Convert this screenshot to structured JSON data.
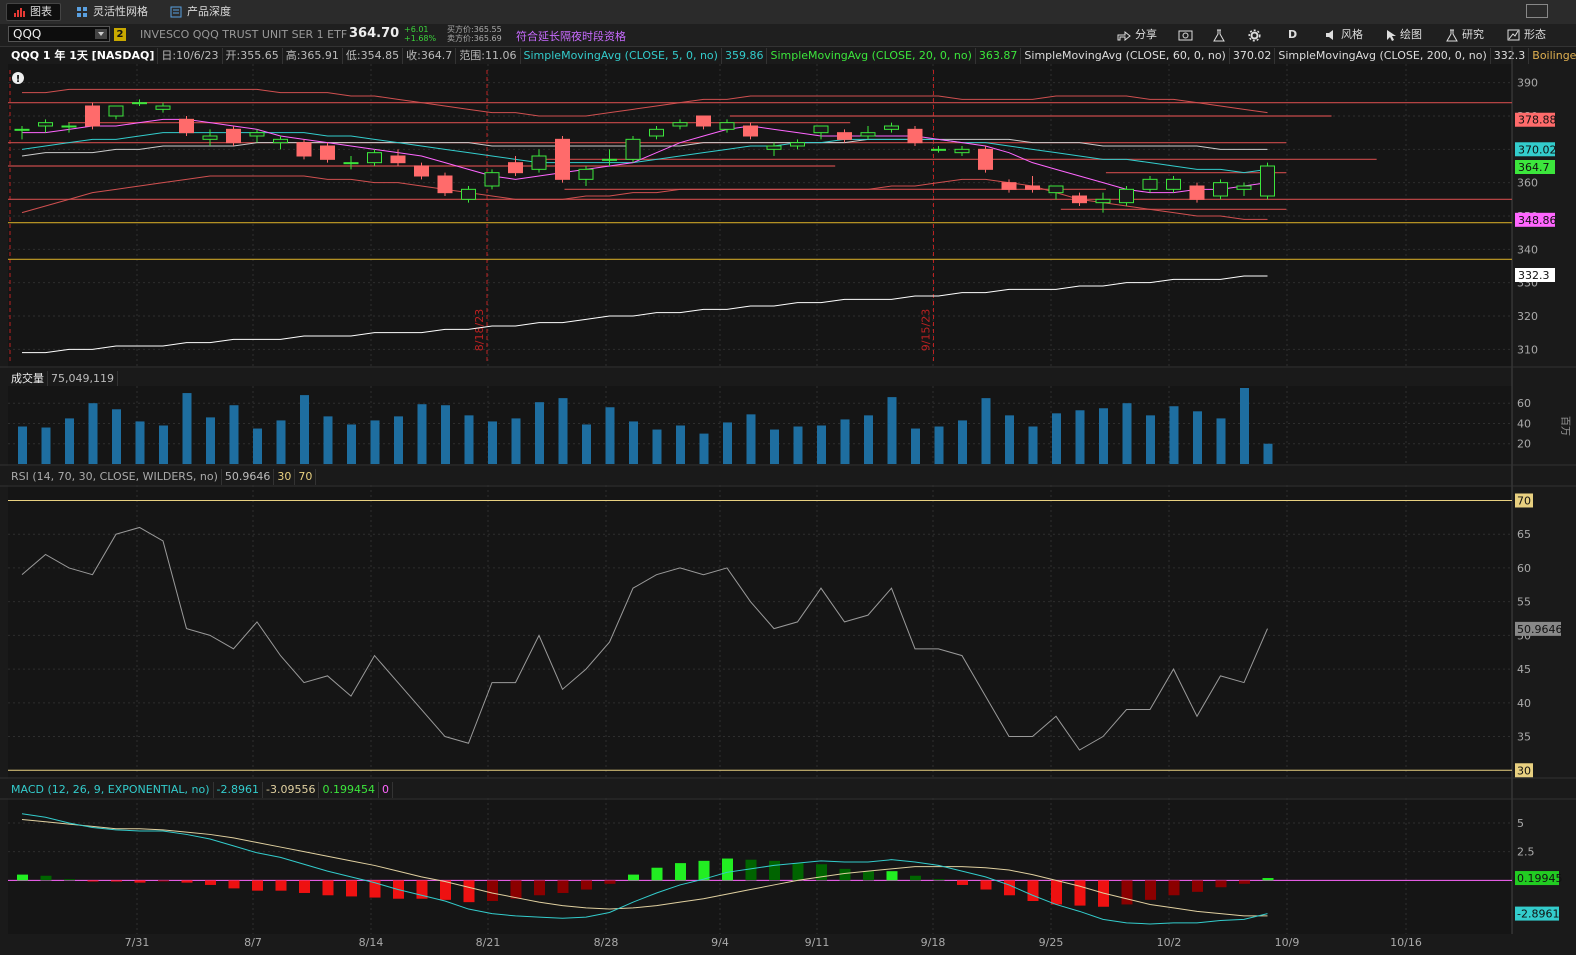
{
  "tabs": [
    {
      "label": "图表",
      "active": true,
      "icon": "bar-chart-icon"
    },
    {
      "label": "灵活性网格",
      "active": false,
      "icon": "grid-icon"
    },
    {
      "label": "产品深度",
      "active": false,
      "icon": "depth-icon"
    }
  ],
  "symbol": "QQQ",
  "link_badge": "2",
  "description": "INVESCO QQQ TRUST UNIT SER 1 ETF",
  "last_price": "364.70",
  "change": "+6.01",
  "change_pct": "+1.68%",
  "bid": "买方价:365.55",
  "ask": "卖方价:365.69",
  "extended_hours": "符合延长隔夜时段资格",
  "toolbar": {
    "share": "分享",
    "period": "D",
    "style": "风格",
    "draw": "绘图",
    "study": "研究",
    "pattern": "形态"
  },
  "price_legend": {
    "title": "QQQ 1 年 1天 [NASDAQ]",
    "date": "日:10/6/23",
    "open": "开:355.65",
    "high": "高:365.91",
    "low": "低:354.85",
    "close": "收:364.7",
    "range": "范围:11.06",
    "sma5": "SimpleMovingAvg (CLOSE, 5, 0, no)",
    "sma5_v": "359.86",
    "sma20": "SimpleMovingAvg (CLOSE, 20, 0, no)",
    "sma20_v": "363.87",
    "sma60": "SimpleMovingAvg (CLOSE, 60, 0, no)",
    "sma60_v": "370.02",
    "sma200": "SimpleMovingAvg (CLOSE, 200, 0, no)",
    "sma200_v": "332.3",
    "bollinger": "Boilinger..."
  },
  "volume_legend": {
    "title": "成交量",
    "value": "75,049,119",
    "unit": "百万"
  },
  "rsi_legend": {
    "title": "RSI (14, 70, 30, CLOSE, WILDERS, no)",
    "value": "50.9646",
    "os": "30",
    "ob": "70"
  },
  "macd_legend": {
    "title": "MACD (12, 26, 9, EXPONENTIAL, no)",
    "value": "-2.8961",
    "avg": "-3.09556",
    "diff": "0.199454",
    "zero": "0"
  },
  "vline_labels": [
    "8/18/23",
    "9/15/23"
  ],
  "colors": {
    "up": "#3ce63c",
    "down": "#ff6b6b",
    "sma5": "#ff66ff",
    "sma20": "#33cccc",
    "sma60": "#cccccc",
    "sma200": "#ffffff",
    "bb": "#d05050",
    "vol": "#1e6ea0",
    "rsi": "#9a9a9a",
    "macd": "#33cccc",
    "macd_avg": "#e0d0a0",
    "hist_up": "#22ee22",
    "hist_up_dim": "#006400",
    "hist_dn": "#ee1111",
    "hist_dn_dim": "#8b0000"
  },
  "chart_data": [
    {
      "type": "candlestick",
      "x_ticks": [
        "7/31",
        "8/7",
        "8/14",
        "8/21",
        "8/28",
        "9/4",
        "9/11",
        "9/18",
        "9/25",
        "10/2",
        "10/9",
        "10/16"
      ],
      "y_ticks": [
        310,
        320,
        330,
        340,
        350,
        360,
        370,
        380,
        390
      ],
      "ylim": [
        305,
        395
      ],
      "candles": [
        {
          "o": 376,
          "h": 377,
          "l": 373,
          "c": 376
        },
        {
          "o": 377,
          "h": 379,
          "l": 375,
          "c": 378
        },
        {
          "o": 377,
          "h": 378,
          "l": 375,
          "c": 377
        },
        {
          "o": 383,
          "h": 384,
          "l": 376,
          "c": 377
        },
        {
          "o": 380,
          "h": 383,
          "l": 379,
          "c": 383
        },
        {
          "o": 384,
          "h": 385,
          "l": 383,
          "c": 384
        },
        {
          "o": 382,
          "h": 384,
          "l": 381,
          "c": 383
        },
        {
          "o": 379,
          "h": 380,
          "l": 374,
          "c": 375
        },
        {
          "o": 373,
          "h": 376,
          "l": 371,
          "c": 374
        },
        {
          "o": 376,
          "h": 377,
          "l": 371,
          "c": 372
        },
        {
          "o": 374,
          "h": 376,
          "l": 372,
          "c": 375
        },
        {
          "o": 372,
          "h": 374,
          "l": 370,
          "c": 373
        },
        {
          "o": 372,
          "h": 373,
          "l": 367,
          "c": 368
        },
        {
          "o": 371,
          "h": 372,
          "l": 366,
          "c": 367
        },
        {
          "o": 366,
          "h": 368,
          "l": 364,
          "c": 366
        },
        {
          "o": 366,
          "h": 370,
          "l": 365,
          "c": 369
        },
        {
          "o": 368,
          "h": 370,
          "l": 365,
          "c": 366
        },
        {
          "o": 365,
          "h": 366,
          "l": 361,
          "c": 362
        },
        {
          "o": 362,
          "h": 363,
          "l": 356,
          "c": 357
        },
        {
          "o": 355,
          "h": 359,
          "l": 354,
          "c": 358
        },
        {
          "o": 359,
          "h": 364,
          "l": 358,
          "c": 363
        },
        {
          "o": 366,
          "h": 368,
          "l": 362,
          "c": 363
        },
        {
          "o": 364,
          "h": 370,
          "l": 363,
          "c": 368
        },
        {
          "o": 373,
          "h": 374,
          "l": 360,
          "c": 361
        },
        {
          "o": 361,
          "h": 365,
          "l": 359,
          "c": 364
        },
        {
          "o": 367,
          "h": 370,
          "l": 365,
          "c": 367
        },
        {
          "o": 367,
          "h": 374,
          "l": 366,
          "c": 373
        },
        {
          "o": 374,
          "h": 377,
          "l": 373,
          "c": 376
        },
        {
          "o": 377,
          "h": 379,
          "l": 376,
          "c": 378
        },
        {
          "o": 380,
          "h": 380,
          "l": 376,
          "c": 377
        },
        {
          "o": 376,
          "h": 379,
          "l": 375,
          "c": 378
        },
        {
          "o": 377,
          "h": 378,
          "l": 373,
          "c": 374
        },
        {
          "o": 370,
          "h": 372,
          "l": 368,
          "c": 371
        },
        {
          "o": 371,
          "h": 373,
          "l": 370,
          "c": 372
        },
        {
          "o": 375,
          "h": 377,
          "l": 373,
          "c": 377
        },
        {
          "o": 375,
          "h": 376,
          "l": 372,
          "c": 373
        },
        {
          "o": 374,
          "h": 377,
          "l": 373,
          "c": 375
        },
        {
          "o": 376,
          "h": 378,
          "l": 375,
          "c": 377
        },
        {
          "o": 376,
          "h": 377,
          "l": 371,
          "c": 372
        },
        {
          "o": 370,
          "h": 371,
          "l": 369,
          "c": 370
        },
        {
          "o": 369,
          "h": 371,
          "l": 368,
          "c": 370
        },
        {
          "o": 370,
          "h": 371,
          "l": 363,
          "c": 364
        },
        {
          "o": 360,
          "h": 361,
          "l": 357,
          "c": 358
        },
        {
          "o": 359,
          "h": 362,
          "l": 357,
          "c": 358
        },
        {
          "o": 357,
          "h": 359,
          "l": 355,
          "c": 359
        },
        {
          "o": 356,
          "h": 357,
          "l": 353,
          "c": 354
        },
        {
          "o": 354,
          "h": 357,
          "l": 351,
          "c": 355
        },
        {
          "o": 354,
          "h": 359,
          "l": 353,
          "c": 358
        },
        {
          "o": 358,
          "h": 362,
          "l": 357,
          "c": 361
        },
        {
          "o": 358,
          "h": 362,
          "l": 357,
          "c": 361
        },
        {
          "o": 359,
          "h": 360,
          "l": 354,
          "c": 355
        },
        {
          "o": 356,
          "h": 361,
          "l": 355,
          "c": 360
        },
        {
          "o": 358,
          "h": 360,
          "l": 356,
          "c": 359
        },
        {
          "o": 356,
          "h": 366,
          "l": 355,
          "c": 365
        }
      ],
      "sma5": [
        375,
        375,
        376,
        377,
        377,
        378,
        379,
        379,
        378,
        377,
        376,
        374,
        373,
        372,
        371,
        370,
        369,
        368,
        366,
        364,
        362,
        361,
        362,
        363,
        364,
        365,
        366,
        369,
        372,
        374,
        376,
        377,
        376,
        375,
        374,
        374,
        374,
        374,
        374,
        373,
        372,
        371,
        369,
        366,
        364,
        362,
        360,
        358,
        357,
        357,
        358,
        358,
        359,
        360
      ],
      "sma20": [
        370,
        371,
        372,
        373,
        373,
        374,
        375,
        375,
        375,
        375,
        375,
        375,
        375,
        374,
        374,
        373,
        372,
        371,
        370,
        369,
        368,
        367,
        366,
        366,
        366,
        366,
        366,
        367,
        368,
        369,
        370,
        371,
        371,
        372,
        372,
        373,
        373,
        373,
        373,
        373,
        372,
        372,
        371,
        370,
        369,
        368,
        367,
        367,
        366,
        365,
        364,
        364,
        363,
        364
      ],
      "sma60": [
        368,
        369,
        369,
        369,
        370,
        370,
        371,
        371,
        371,
        371,
        372,
        372,
        372,
        372,
        372,
        372,
        372,
        372,
        372,
        372,
        371,
        371,
        371,
        371,
        371,
        371,
        371,
        371,
        371,
        372,
        372,
        372,
        372,
        372,
        372,
        372,
        373,
        373,
        373,
        373,
        373,
        373,
        373,
        372,
        372,
        372,
        371,
        371,
        371,
        371,
        371,
        370,
        370,
        370
      ],
      "sma200": [
        309,
        309,
        310,
        310,
        311,
        311,
        311,
        312,
        312,
        313,
        313,
        313,
        314,
        314,
        314,
        315,
        315,
        315,
        316,
        316,
        317,
        317,
        318,
        318,
        319,
        320,
        320,
        321,
        321,
        322,
        322,
        323,
        323,
        324,
        324,
        325,
        325,
        325,
        326,
        326,
        327,
        327,
        328,
        328,
        328,
        329,
        329,
        330,
        330,
        331,
        331,
        331,
        332,
        332
      ],
      "bb_upper": [
        387,
        387,
        388,
        388,
        388,
        388,
        388,
        388,
        388,
        388,
        388,
        387,
        387,
        387,
        386,
        386,
        385,
        384,
        383,
        382,
        381,
        381,
        380,
        380,
        380,
        381,
        382,
        383,
        384,
        385,
        385,
        386,
        386,
        386,
        386,
        386,
        386,
        386,
        386,
        386,
        385,
        385,
        385,
        385,
        386,
        386,
        386,
        386,
        385,
        385,
        384,
        383,
        382,
        381
      ],
      "bb_lower": [
        351,
        353,
        355,
        357,
        358,
        359,
        360,
        361,
        362,
        362,
        362,
        362,
        362,
        361,
        361,
        360,
        360,
        359,
        358,
        357,
        356,
        355,
        355,
        355,
        356,
        356,
        357,
        357,
        358,
        358,
        358,
        358,
        358,
        358,
        358,
        358,
        358,
        359,
        359,
        360,
        361,
        361,
        360,
        359,
        357,
        355,
        354,
        353,
        352,
        351,
        350,
        350,
        349,
        349
      ],
      "levels": [
        {
          "y": 384,
          "x0": 0,
          "x1": 1.0,
          "color": "#c84a4a"
        },
        {
          "y": 380,
          "x0": 0.48,
          "x1": 0.88,
          "color": "#c84a4a"
        },
        {
          "y": 378,
          "x0": 0.04,
          "x1": 0.56,
          "color": "#c84a4a"
        },
        {
          "y": 372,
          "x0": 0,
          "x1": 0.85,
          "color": "#c84a4a"
        },
        {
          "y": 367,
          "x0": 0.35,
          "x1": 0.91,
          "color": "#c84a4a"
        },
        {
          "y": 365,
          "x0": 0,
          "x1": 0.55,
          "color": "#c84a4a"
        },
        {
          "y": 363,
          "x0": 0.73,
          "x1": 0.85,
          "color": "#c84a4a"
        },
        {
          "y": 358,
          "x0": 0.37,
          "x1": 0.73,
          "color": "#c84a4a"
        },
        {
          "y": 355,
          "x0": 0,
          "x1": 1.0,
          "color": "#c84a4a"
        },
        {
          "y": 352,
          "x0": 0.7,
          "x1": 0.85,
          "color": "#c84a4a"
        },
        {
          "y": 348,
          "x0": 0,
          "x1": 1.0,
          "color": "#c9a227"
        },
        {
          "y": 337,
          "x0": 0,
          "x1": 1.0,
          "color": "#c9a227"
        }
      ],
      "price_labels": [
        {
          "value": "378.88",
          "y": 378.88,
          "bg": "#ff6b6b",
          "fg": "#111"
        },
        {
          "value": "370.02",
          "y": 370.02,
          "bg": "#33cccc",
          "fg": "#111"
        },
        {
          "value": "364.7",
          "y": 364.7,
          "bg": "#3ce63c",
          "fg": "#111"
        },
        {
          "value": "348.86",
          "y": 348.86,
          "bg": "#ff66ff",
          "fg": "#111"
        },
        {
          "value": "332.3",
          "y": 332.3,
          "bg": "#ffffff",
          "fg": "#111"
        }
      ]
    },
    {
      "type": "bar",
      "name": "volume",
      "y_ticks": [
        20,
        40,
        60
      ],
      "ylim": [
        0,
        75
      ],
      "values": [
        37,
        36,
        45,
        60,
        54,
        42,
        38,
        70,
        46,
        58,
        35,
        43,
        68,
        47,
        39,
        43,
        47,
        59,
        58,
        48,
        42,
        45,
        61,
        65,
        39,
        56,
        42,
        34,
        38,
        30,
        41,
        49,
        34,
        37,
        38,
        44,
        48,
        66,
        35,
        37,
        43,
        65,
        48,
        37,
        50,
        53,
        55,
        60,
        48,
        57,
        52,
        45,
        75,
        20
      ]
    },
    {
      "type": "line",
      "name": "RSI",
      "y_ticks": [
        35,
        40,
        45,
        50,
        55,
        60,
        65
      ],
      "ylim": [
        29,
        72
      ],
      "levels": [
        30,
        70
      ],
      "values": [
        59,
        62,
        60,
        59,
        65,
        66,
        64,
        51,
        50,
        48,
        52,
        47,
        43,
        44,
        41,
        47,
        43,
        39,
        35,
        34,
        43,
        43,
        50,
        42,
        45,
        49,
        57,
        59,
        60,
        59,
        60,
        55,
        51,
        52,
        57,
        52,
        53,
        57,
        48,
        48,
        47,
        41,
        35,
        35,
        38,
        33,
        35,
        39,
        39,
        45,
        38,
        44,
        43,
        51
      ]
    },
    {
      "type": "line",
      "name": "MACD",
      "y_ticks": [
        2.5,
        5
      ],
      "ylim": [
        -4.5,
        7.0
      ],
      "zero": 0,
      "macd": [
        5.8,
        5.5,
        5.0,
        4.6,
        4.4,
        4.3,
        4.3,
        4.0,
        3.6,
        3.0,
        2.4,
        2.0,
        1.4,
        0.8,
        0.3,
        -0.2,
        -0.8,
        -1.3,
        -1.8,
        -2.5,
        -2.9,
        -3.1,
        -3.2,
        -3.3,
        -3.2,
        -2.8,
        -1.9,
        -1.1,
        -0.4,
        0.1,
        0.7,
        1.0,
        1.3,
        1.5,
        1.7,
        1.6,
        1.6,
        1.8,
        1.6,
        1.3,
        0.8,
        0.3,
        -0.4,
        -1.3,
        -2.1,
        -2.7,
        -3.4,
        -3.7,
        -3.8,
        -3.7,
        -3.7,
        -3.5,
        -3.4,
        -2.9
      ],
      "avg": [
        5.3,
        5.1,
        4.9,
        4.7,
        4.5,
        4.5,
        4.4,
        4.2,
        4.0,
        3.7,
        3.3,
        2.9,
        2.5,
        2.1,
        1.7,
        1.3,
        0.8,
        0.3,
        -0.1,
        -0.6,
        -1.1,
        -1.5,
        -1.9,
        -2.2,
        -2.4,
        -2.5,
        -2.4,
        -2.2,
        -1.9,
        -1.6,
        -1.2,
        -0.8,
        -0.4,
        0.0,
        0.3,
        0.6,
        0.8,
        1.0,
        1.2,
        1.2,
        1.2,
        1.1,
        0.9,
        0.5,
        0.0,
        -0.5,
        -1.1,
        -1.6,
        -2.1,
        -2.4,
        -2.7,
        -2.9,
        -3.1,
        -3.1
      ],
      "hist": [
        0.5,
        0.4,
        0.1,
        -0.1,
        -0.1,
        -0.2,
        -0.1,
        -0.2,
        -0.4,
        -0.7,
        -0.9,
        -0.9,
        -1.1,
        -1.3,
        -1.4,
        -1.5,
        -1.6,
        -1.6,
        -1.7,
        -1.9,
        -1.8,
        -1.6,
        -1.3,
        -1.1,
        -0.8,
        -0.3,
        0.5,
        1.1,
        1.5,
        1.7,
        1.9,
        1.8,
        1.7,
        1.5,
        1.4,
        1.0,
        0.8,
        0.8,
        0.4,
        0.1,
        -0.4,
        -0.8,
        -1.3,
        -1.8,
        -2.1,
        -2.2,
        -2.3,
        -2.1,
        -1.7,
        -1.3,
        -1.0,
        -0.6,
        -0.3,
        0.2
      ]
    }
  ]
}
